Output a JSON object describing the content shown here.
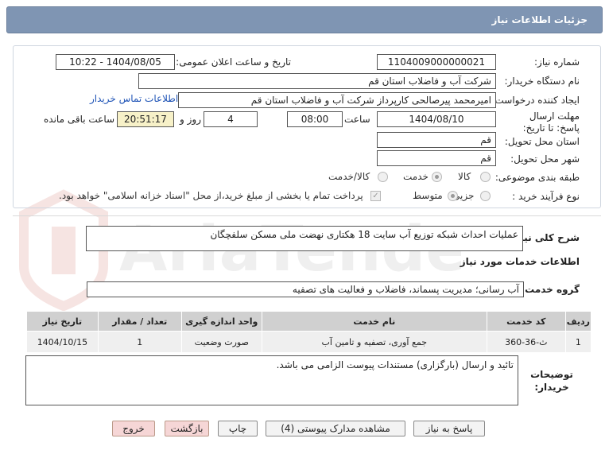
{
  "header": {
    "title": "جزئیات اطلاعات نیاز"
  },
  "form": {
    "need_number_label": "شماره نیاز:",
    "need_number": "1104009000000021",
    "announce_label": "تاریخ و ساعت اعلان عمومی:",
    "announce_value": "1404/08/05 - 10:22",
    "buyer_org_label": "نام دستگاه خریدار:",
    "buyer_org": "شرکت آب و فاضلاب استان قم",
    "creator_label": "ایجاد کننده درخواست:",
    "creator": "امیرمحمد پیرصالحی کارپرداز شرکت آب و فاضلاب استان قم",
    "contact_link": "اطلاعات تماس خریدار",
    "deadline_label": "مهلت ارسال پاسخ: تا تاریخ:",
    "deadline_date": "1404/08/10",
    "time_label": "ساعت",
    "deadline_time": "08:00",
    "days_value": "4",
    "days_label": "روز و",
    "remaining_time": "20:51:17",
    "remaining_label": "ساعت باقی مانده",
    "province_label": "استان محل تحویل:",
    "province": "قم",
    "city_label": "شهر محل تحویل:",
    "city": "قم",
    "category_label": "طبقه بندی موضوعی:",
    "category_options": [
      "کالا",
      "خدمت",
      "کالا/خدمت"
    ],
    "purchase_type_label": "نوع فرآیند خرید :",
    "purchase_options": [
      "جزیی",
      "متوسط"
    ],
    "payment_note": "پرداخت تمام یا بخشی از مبلغ خرید،از محل \"اسناد خزانه اسلامی\" خواهد بود."
  },
  "summary": {
    "label": "شرح کلی نیاز:",
    "text": "عملیات احداث شبکه توزیع آب سایت 18 هکتاری نهضت ملی مسکن سلفچگان"
  },
  "services": {
    "section_title": "اطلاعات خدمات مورد نیاز",
    "group_label": "گروه خدمت:",
    "group_value": "آب رسانی؛ مدیریت پسماند، فاضلاب و فعالیت های تصفیه",
    "columns": [
      "ردیف",
      "کد خدمت",
      "نام خدمت",
      "واحد اندازه گیری",
      "تعداد / مقدار",
      "تاریخ نیاز"
    ],
    "rows": [
      {
        "row": "1",
        "code": "ث-36-360",
        "name": "جمع آوری، تصفیه و تامین آب",
        "unit": "صورت وضعیت",
        "qty": "1",
        "date": "1404/10/15"
      }
    ]
  },
  "notes": {
    "label": "توضیحات خریدار:",
    "text": "تائید و ارسال (بارگزاری) مستندات پیوست الزامی می باشد."
  },
  "buttons": {
    "reply": "پاسخ به نیاز",
    "attachments": "مشاهده مدارک پیوستی (4)",
    "print": "چاپ",
    "back": "بازگشت",
    "exit": "خروج"
  },
  "watermark": {
    "text": "AriaTender.net"
  }
}
